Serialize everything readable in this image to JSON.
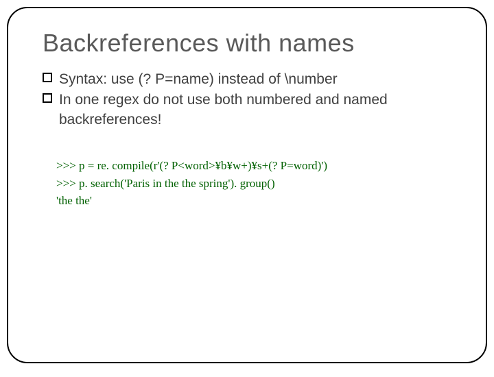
{
  "title": "Backreferences with names",
  "bullets": [
    "Syntax: use (? P=name) instead of \\number",
    "In one regex do not use both numbered and named backreferences!"
  ],
  "code": {
    "line1": ">>> p = re. compile(r'(? P<word>¥b¥w+)¥s+(? P=word)')",
    "line2": ">>> p. search('Paris in the the spring'). group()",
    "line3": "'the the'"
  }
}
